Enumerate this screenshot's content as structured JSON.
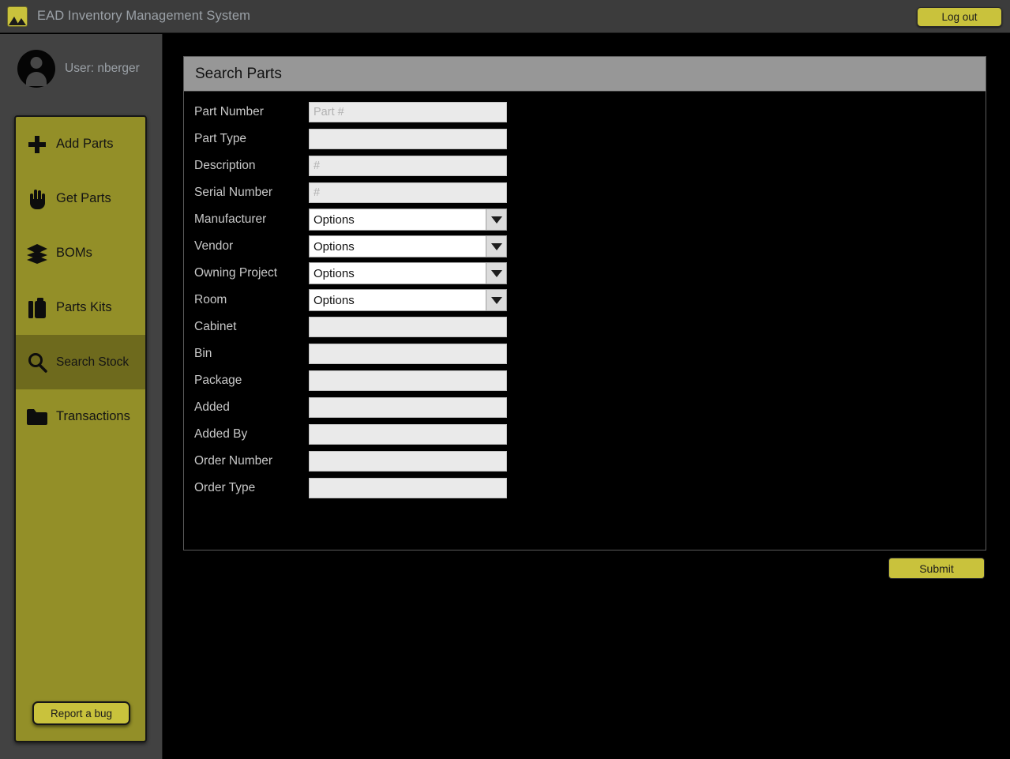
{
  "titlebar": {
    "app_title": "EAD Inventory Management System",
    "logo_icon": "mountains-icon",
    "logout_label": "Log out"
  },
  "sidebar": {
    "user_label": "User: nberger",
    "avatar_icon": "user-avatar-icon",
    "items": [
      {
        "label": "Add Parts",
        "icon": "plus-icon",
        "active": false
      },
      {
        "label": "Get Parts",
        "icon": "hand-icon",
        "active": false
      },
      {
        "label": "BOMs",
        "icon": "layers-icon",
        "active": false
      },
      {
        "label": "Parts Kits",
        "icon": "briefcase-icon",
        "active": false
      },
      {
        "label": "Search Stock",
        "icon": "search-icon",
        "active": true
      },
      {
        "label": "Transactions",
        "icon": "folder-icon",
        "active": false
      }
    ],
    "report_bug_label": "Report a bug"
  },
  "main": {
    "card_title": "Search Parts",
    "submit_label": "Submit",
    "fields": [
      {
        "label": "Part Number",
        "type": "text",
        "value": "",
        "placeholder": "Part #"
      },
      {
        "label": "Part Type",
        "type": "text",
        "value": "",
        "placeholder": ""
      },
      {
        "label": "Description",
        "type": "text",
        "value": "",
        "placeholder": "#"
      },
      {
        "label": "Serial Number",
        "type": "text",
        "value": "",
        "placeholder": "#"
      },
      {
        "label": "Manufacturer",
        "type": "select",
        "value": "Options",
        "placeholder": ""
      },
      {
        "label": "Vendor",
        "type": "select",
        "value": "Options",
        "placeholder": ""
      },
      {
        "label": "Owning Project",
        "type": "select",
        "value": "Options",
        "placeholder": ""
      },
      {
        "label": "Room",
        "type": "select",
        "value": "Options",
        "placeholder": ""
      },
      {
        "label": "Cabinet",
        "type": "text",
        "value": "",
        "placeholder": ""
      },
      {
        "label": "Bin",
        "type": "text",
        "value": "",
        "placeholder": ""
      },
      {
        "label": "Package",
        "type": "text",
        "value": "",
        "placeholder": ""
      },
      {
        "label": "Added",
        "type": "text",
        "value": "",
        "placeholder": ""
      },
      {
        "label": "Added By",
        "type": "text",
        "value": "",
        "placeholder": ""
      },
      {
        "label": "Order Number",
        "type": "text",
        "value": "",
        "placeholder": ""
      },
      {
        "label": "Order Type",
        "type": "text",
        "value": "",
        "placeholder": ""
      }
    ]
  },
  "colors": {
    "accent": "#c9c23c",
    "nav_panel": "#938f28",
    "nav_active": "#6e6a1d",
    "chrome": "#3c3c3c",
    "sidebar": "#424242",
    "card_header": "#979797",
    "background": "#000000"
  }
}
